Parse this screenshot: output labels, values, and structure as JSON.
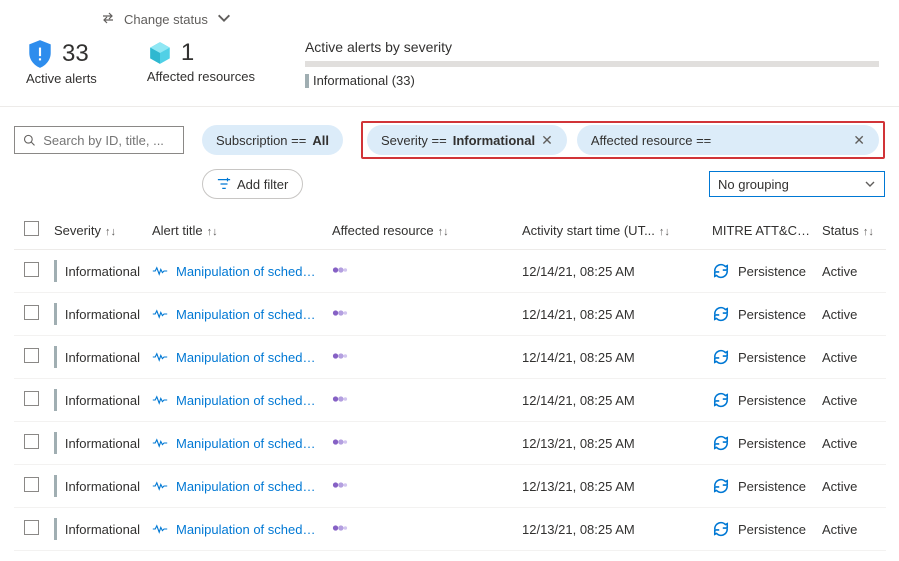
{
  "topbar": {
    "change_status": "Change status"
  },
  "summary": {
    "active_alerts_count": "33",
    "active_alerts_label": "Active alerts",
    "affected_resources_count": "1",
    "affected_resources_label": "Affected resources",
    "severity_title": "Active alerts by severity",
    "severity_breakdown": "Informational (33)"
  },
  "filters": {
    "search_placeholder": "Search by ID, title, ...",
    "subscription_label": "Subscription == ",
    "subscription_value": "All",
    "severity_label": "Severity == ",
    "severity_value": "Informational",
    "affected_label": "Affected resource ==",
    "add_filter": "Add filter",
    "grouping": "No grouping"
  },
  "columns": {
    "severity": "Severity",
    "title": "Alert title",
    "resource": "Affected resource",
    "time": "Activity start time (UT...",
    "mitre": "MITRE ATT&CK...",
    "status": "Status"
  },
  "rows": [
    {
      "severity": "Informational",
      "title": "Manipulation of schedu...",
      "time": "12/14/21, 08:25 AM",
      "mitre": "Persistence",
      "status": "Active"
    },
    {
      "severity": "Informational",
      "title": "Manipulation of schedu...",
      "time": "12/14/21, 08:25 AM",
      "mitre": "Persistence",
      "status": "Active"
    },
    {
      "severity": "Informational",
      "title": "Manipulation of schedu...",
      "time": "12/14/21, 08:25 AM",
      "mitre": "Persistence",
      "status": "Active"
    },
    {
      "severity": "Informational",
      "title": "Manipulation of schedu...",
      "time": "12/14/21, 08:25 AM",
      "mitre": "Persistence",
      "status": "Active"
    },
    {
      "severity": "Informational",
      "title": "Manipulation of schedu...",
      "time": "12/13/21, 08:25 AM",
      "mitre": "Persistence",
      "status": "Active"
    },
    {
      "severity": "Informational",
      "title": "Manipulation of schedu...",
      "time": "12/13/21, 08:25 AM",
      "mitre": "Persistence",
      "status": "Active"
    },
    {
      "severity": "Informational",
      "title": "Manipulation of schedu...",
      "time": "12/13/21, 08:25 AM",
      "mitre": "Persistence",
      "status": "Active"
    }
  ]
}
